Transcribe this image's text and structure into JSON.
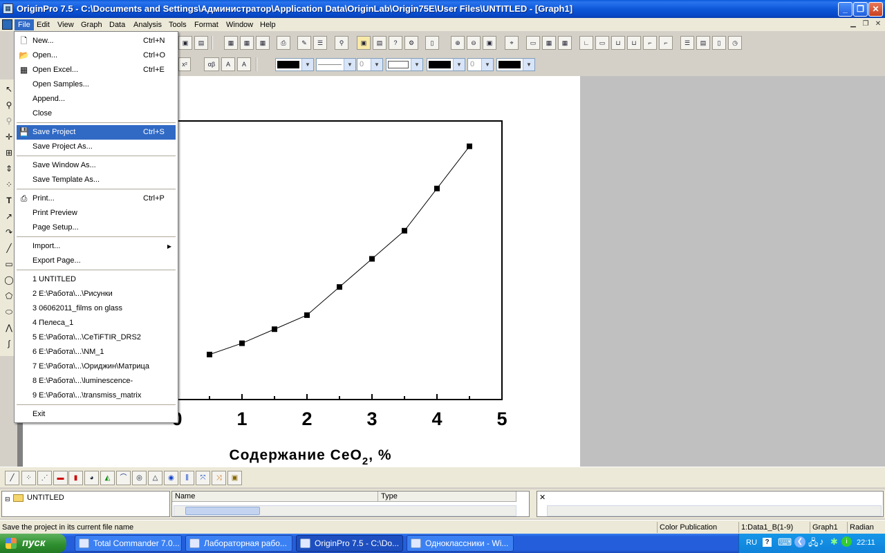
{
  "window": {
    "title": "OriginPro 7.5 - C:\\Documents and Settings\\Администратор\\Application Data\\OriginLab\\Origin75E\\User Files\\UNTITLED - [Graph1]"
  },
  "menubar": {
    "items": [
      "File",
      "Edit",
      "View",
      "Graph",
      "Data",
      "Analysis",
      "Tools",
      "Format",
      "Window",
      "Help"
    ],
    "active": "File"
  },
  "file_menu": {
    "groups": [
      [
        {
          "label": "New...",
          "shortcut": "Ctrl+N",
          "icon": "new-file-icon"
        },
        {
          "label": "Open...",
          "shortcut": "Ctrl+O",
          "icon": "open-folder-icon"
        },
        {
          "label": "Open Excel...",
          "shortcut": "Ctrl+E",
          "icon": "open-excel-icon"
        },
        {
          "label": "Open Samples...",
          "shortcut": ""
        },
        {
          "label": "Append...",
          "shortcut": ""
        },
        {
          "label": "Close",
          "shortcut": ""
        }
      ],
      [
        {
          "label": "Save Project",
          "shortcut": "Ctrl+S",
          "icon": "floppy-disk-icon",
          "highlighted": true
        },
        {
          "label": "Save Project As...",
          "shortcut": ""
        }
      ],
      [
        {
          "label": "Save Window As...",
          "shortcut": ""
        },
        {
          "label": "Save Template As...",
          "shortcut": ""
        }
      ],
      [
        {
          "label": "Print...",
          "shortcut": "Ctrl+P",
          "icon": "printer-icon"
        },
        {
          "label": "Print Preview",
          "shortcut": ""
        },
        {
          "label": "Page Setup...",
          "shortcut": ""
        }
      ],
      [
        {
          "label": "Import...",
          "shortcut": "",
          "submenu": true
        },
        {
          "label": "Export Page...",
          "shortcut": ""
        }
      ],
      [
        {
          "label": "1 UNTITLED"
        },
        {
          "label": "2 E:\\Работа\\...\\Рисунки"
        },
        {
          "label": "3 06062011_films on glass"
        },
        {
          "label": "4 Пелеса_1"
        },
        {
          "label": "5 E:\\Работа\\...\\CeTiFTIR_DRS2"
        },
        {
          "label": "6 E:\\Работа\\...\\NM_1"
        },
        {
          "label": "7 E:\\Работа\\...\\Ориджин\\Матрица"
        },
        {
          "label": "8 E:\\Работа\\...\\luminescence-"
        },
        {
          "label": "9 E:\\Работа\\...\\transmiss_matrix"
        }
      ],
      [
        {
          "label": "Exit",
          "shortcut": ""
        }
      ]
    ]
  },
  "format_toolbar": {
    "line_width_value": "0",
    "size_value": "0"
  },
  "chart_data": {
    "type": "line",
    "x": [
      0.5,
      1,
      1.5,
      2,
      2.5,
      3,
      3.5,
      4,
      4.5
    ],
    "y": [
      0.16,
      0.2,
      0.25,
      0.3,
      0.4,
      0.5,
      0.6,
      0.75,
      0.9
    ],
    "xlabel_parts": {
      "prefix": "Содержание CeO",
      "subscript": "2",
      "suffix": ", %"
    },
    "xticks": [
      "0",
      "1",
      "2",
      "3",
      "4",
      "5"
    ],
    "xlim": [
      0,
      5
    ],
    "ylim": [
      0,
      0.99
    ],
    "marker": "square",
    "grid": false
  },
  "explorer": {
    "folder": "UNTITLED",
    "columns": [
      "Name",
      "Type"
    ]
  },
  "statusbar": {
    "message": "Save the project in its current file name",
    "theme": "Color Publication",
    "active_data": "1:Data1_B(1-9)",
    "active_window": "Graph1",
    "angle_unit": "Radian"
  },
  "taskbar": {
    "start": "пуск",
    "tasks": [
      "Total Commander 7.0...",
      "Лабораторная рабо...",
      "OriginPro 7.5 - C:\\Do...",
      "Одноклассники - Wi..."
    ],
    "active_task_index": 2,
    "language": "RU",
    "clock": "22:11"
  },
  "colors": {
    "selection": "#316ac5",
    "titlebar": "#0a5ad8",
    "taskbar": "#245edb",
    "start_button": "#2f8f2f"
  }
}
